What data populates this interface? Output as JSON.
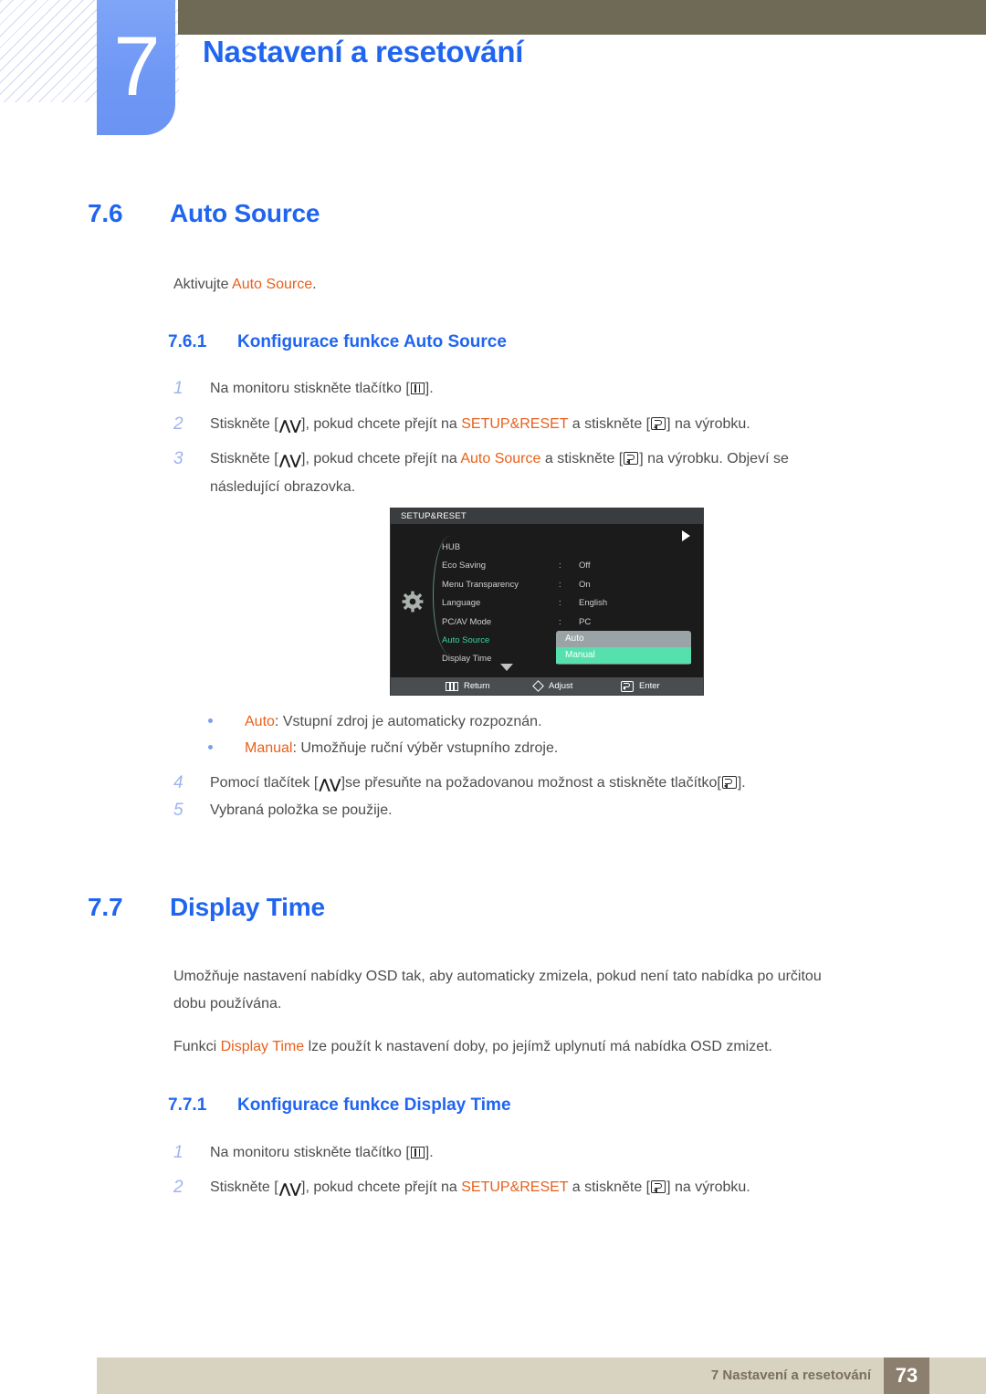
{
  "header": {
    "chapter_number": "7",
    "chapter_title": "Nastavení a resetování"
  },
  "sections": {
    "s76": {
      "number": "7.6",
      "title": "Auto Source",
      "intro_prefix": "Aktivujte ",
      "intro_highlight": "Auto Source",
      "intro_suffix": ".",
      "sub": {
        "number": "7.6.1",
        "title": "Konfigurace funkce Auto Source"
      },
      "steps": [
        {
          "n": "1",
          "p1": "Na monitoru stiskněte tlačítko [",
          "icon": "menu-key-icon",
          "p2": "].",
          "p3": "",
          "hl": "",
          "p4": ""
        },
        {
          "n": "2",
          "p1": "Stiskněte [",
          "icon": "up-down-key-icon",
          "p2": "], pokud chcete přejít na ",
          "hl": "SETUP&RESET",
          "p3": " a stiskněte [",
          "icon2": "enter-key-icon",
          "p4": "] na výrobku."
        },
        {
          "n": "3",
          "p1": "Stiskněte [",
          "icon": "up-down-key-icon",
          "p2": "], pokud chcete přejít na ",
          "hl": "Auto Source",
          "p3": " a stiskněte [",
          "icon2": "enter-key-icon",
          "p4": "] na výrobku. Objeví se",
          "line2": "následující obrazovka."
        }
      ],
      "bullets": [
        {
          "hl": "Auto",
          "text": ": Vstupní zdroj je automaticky rozpoznán."
        },
        {
          "hl": "Manual",
          "text": ": Umožňuje ruční výběr vstupního zdroje."
        }
      ],
      "steps2": [
        {
          "n": "4",
          "p1": "Pomocí tlačítek [",
          "icon": "up-down-key-icon",
          "p2": "]se přesuňte na požadovanou možnost a stiskněte tlačítko[",
          "icon2": "enter-key-icon",
          "p3": "]."
        },
        {
          "n": "5",
          "p1": "Vybraná položka se použije."
        }
      ]
    },
    "s77": {
      "number": "7.7",
      "title": "Display Time",
      "para1": "Umožňuje nastavení nabídky OSD tak, aby automaticky zmizela, pokud není tato nabídka po určitou",
      "para1b": "dobu používána.",
      "para2_prefix": "Funkci ",
      "para2_highlight": "Display Time",
      "para2_suffix": " lze použít k nastavení doby, po jejímž uplynutí má nabídka OSD zmizet.",
      "sub": {
        "number": "7.7.1",
        "title": "Konfigurace funkce Display Time"
      },
      "steps": [
        {
          "n": "1",
          "p1": "Na monitoru stiskněte tlačítko [",
          "icon": "menu-key-icon",
          "p2": "]."
        },
        {
          "n": "2",
          "p1": "Stiskněte [",
          "icon": "up-down-key-icon",
          "p2": "], pokud chcete přejít na ",
          "hl": "SETUP&RESET",
          "p3": " a stiskněte [",
          "icon2": "enter-key-icon",
          "p4": "] na výrobku."
        }
      ]
    }
  },
  "osd": {
    "title": "SETUP&RESET",
    "rows": [
      {
        "label": "HUB",
        "colon": "",
        "value": "",
        "active": false
      },
      {
        "label": "Eco Saving",
        "colon": ":",
        "value": "Off",
        "active": false
      },
      {
        "label": "Menu Transparency",
        "colon": ":",
        "value": "On",
        "active": false
      },
      {
        "label": "Language",
        "colon": ":",
        "value": "English",
        "active": false
      },
      {
        "label": "PC/AV Mode",
        "colon": ":",
        "value": "PC",
        "active": false
      },
      {
        "label": "Auto Source",
        "colon": ":",
        "value": "",
        "active": true
      },
      {
        "label": "Display Time",
        "colon": ":",
        "value": "",
        "active": false
      }
    ],
    "popup": {
      "options": [
        "Auto",
        "Manual"
      ],
      "selected": "Manual"
    },
    "bottom": {
      "return": "Return",
      "adjust": "Adjust",
      "enter": "Enter"
    }
  },
  "footer": {
    "text": "7 Nastavení a resetování",
    "page": "73"
  },
  "colors": {
    "heading_blue": "#2065f0",
    "highlight_orange": "#e8601c",
    "step_number_blue": "#9db4ef",
    "olive": "#6e6a56",
    "tab_blue": "#6f98f5",
    "footer_bar": "#d8d2c0",
    "footer_page": "#8d7f6e",
    "osd_green": "#35d79a",
    "osd_select": "#56e0ae"
  }
}
